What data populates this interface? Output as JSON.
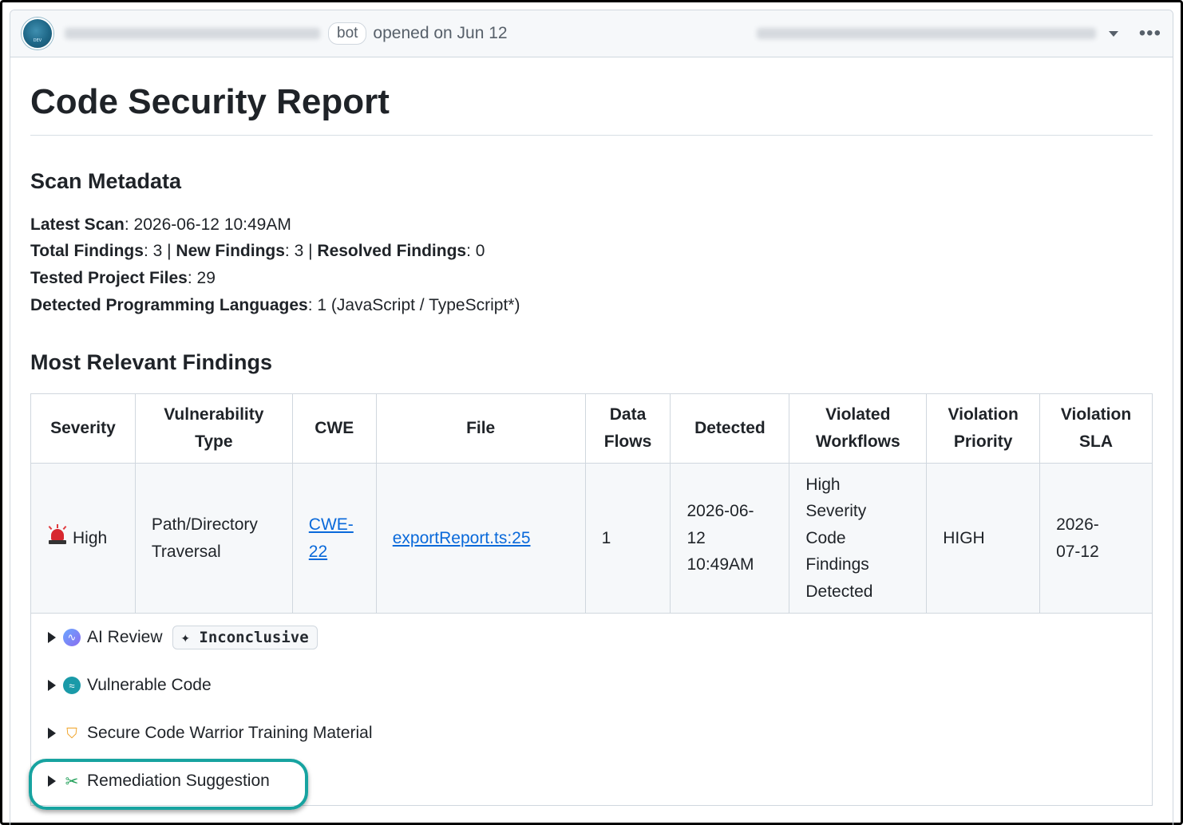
{
  "header": {
    "bot_label": "bot",
    "opened_text": "opened on Jun 12",
    "more_icon": "kebab-horizontal-icon"
  },
  "report": {
    "title": "Code Security Report",
    "scan_metadata": {
      "heading": "Scan Metadata",
      "latest_scan_label": "Latest Scan",
      "latest_scan_value": ": 2026-06-12 10:49AM",
      "total_findings_label": "Total Findings",
      "total_findings_value": ": 3 | ",
      "new_findings_label": "New Findings",
      "new_findings_value": ": 3 | ",
      "resolved_findings_label": "Resolved Findings",
      "resolved_findings_value": ": 0",
      "tested_files_label": "Tested Project Files",
      "tested_files_value": ": 29",
      "languages_label": "Detected Programming Languages",
      "languages_value": ": 1 (JavaScript / TypeScript*)"
    },
    "findings": {
      "heading": "Most Relevant Findings",
      "columns": {
        "severity": "Severity",
        "vuln_type_1": "Vulnerability",
        "vuln_type_2": "Type",
        "cwe": "CWE",
        "file": "File",
        "data_flows_1": "Data",
        "data_flows_2": "Flows",
        "detected": "Detected",
        "workflows_1": "Violated",
        "workflows_2": "Workflows",
        "priority_1": "Violation",
        "priority_2": "Priority",
        "sla_1": "Violation",
        "sla_2": "SLA"
      },
      "row": {
        "severity": "High",
        "vuln_type_1": "Path/Directory",
        "vuln_type_2": "Traversal",
        "cwe_1": "CWE-",
        "cwe_2": "22",
        "file": "exportReport.ts:25",
        "data_flows": "1",
        "detected_1": "2026-06-",
        "detected_2": "12",
        "detected_3": "10:49AM",
        "workflows_1": "High",
        "workflows_2": "Severity",
        "workflows_3": "Code",
        "workflows_4": "Findings",
        "workflows_5": "Detected",
        "priority": "HIGH",
        "sla_1": "2026-",
        "sla_2": "07-12"
      },
      "details": {
        "ai_review": "AI Review",
        "ai_badge": "✦ Inconclusive",
        "vulnerable_code": "Vulnerable Code",
        "training": "Secure Code Warrior Training Material",
        "remediation": "Remediation Suggestion"
      }
    }
  },
  "colors": {
    "link": "#0969da",
    "highlight": "#17a3a0",
    "severity_high": "#d7272f"
  }
}
